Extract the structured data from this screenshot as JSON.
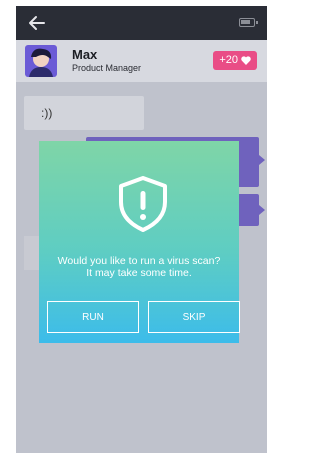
{
  "header": {
    "name": "Max",
    "role": "Product Manager",
    "badge_value": "+20"
  },
  "chat": {
    "incoming_text": ":))"
  },
  "dialog": {
    "line1": "Would you like to run a virus scan?",
    "line2": "It may take some time.",
    "run_label": "RUN",
    "skip_label": "SKIP"
  },
  "icons": {
    "back": "back-arrow-icon",
    "battery": "battery-icon",
    "heart": "heart-icon",
    "shield": "shield-alert-icon"
  },
  "colors": {
    "badge": "#e94d86",
    "bubble_out": "#6f62bd",
    "dialog_top": "#7fd5a7",
    "dialog_bottom": "#3cbcea"
  }
}
